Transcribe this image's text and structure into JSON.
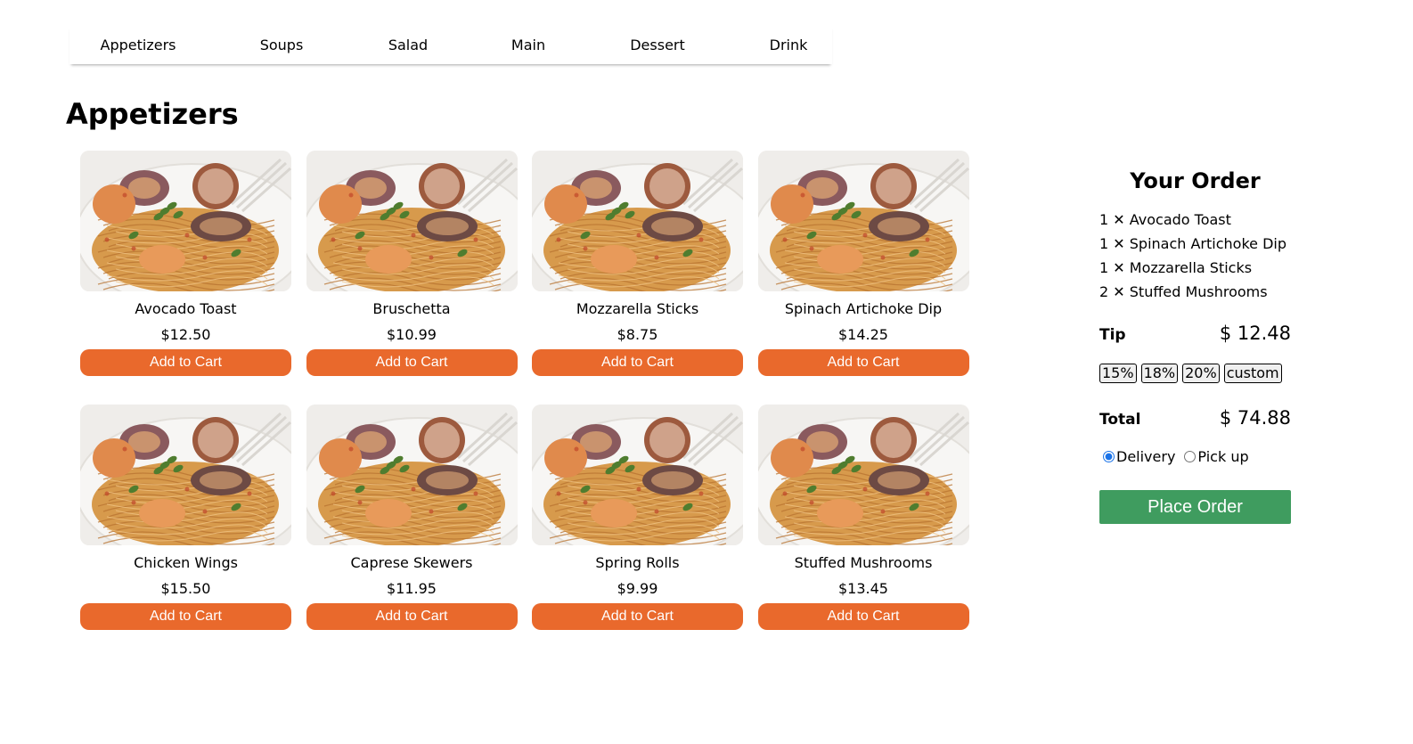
{
  "nav": {
    "categories": [
      "Appetizers",
      "Soups",
      "Salad",
      "Main",
      "Dessert",
      "Drink"
    ]
  },
  "section": {
    "title": "Appetizers"
  },
  "menu": {
    "items": [
      {
        "name": "Avocado Toast",
        "price": "$12.50",
        "button": "Add to Cart"
      },
      {
        "name": "Bruschetta",
        "price": "$10.99",
        "button": "Add to Cart"
      },
      {
        "name": "Mozzarella Sticks",
        "price": "$8.75",
        "button": "Add to Cart"
      },
      {
        "name": "Spinach Artichoke Dip",
        "price": "$14.25",
        "button": "Add to Cart"
      },
      {
        "name": "Chicken Wings",
        "price": "$15.50",
        "button": "Add to Cart"
      },
      {
        "name": "Caprese Skewers",
        "price": "$11.95",
        "button": "Add to Cart"
      },
      {
        "name": "Spring Rolls",
        "price": "$9.99",
        "button": "Add to Cart"
      },
      {
        "name": "Stuffed Mushrooms",
        "price": "$13.45",
        "button": "Add to Cart"
      }
    ]
  },
  "order": {
    "title": "Your Order",
    "lines": [
      "1 ✕ Avocado Toast",
      "1 ✕ Spinach Artichoke Dip",
      "1 ✕ Mozzarella Sticks",
      "2 ✕ Stuffed Mushrooms"
    ],
    "tip_label": "Tip",
    "tip_value": "$ 12.48",
    "tip_options": [
      "15%",
      "18%",
      "20%",
      "custom"
    ],
    "total_label": "Total",
    "total_value": "$ 74.88",
    "modes": [
      {
        "label": "Delivery",
        "selected": true
      },
      {
        "label": "Pick up",
        "selected": false
      }
    ],
    "place_label": "Place Order"
  },
  "colors": {
    "add_button": "#e9692c",
    "place_button": "#3f9c5f",
    "radio_selected": "#1a73e8"
  }
}
